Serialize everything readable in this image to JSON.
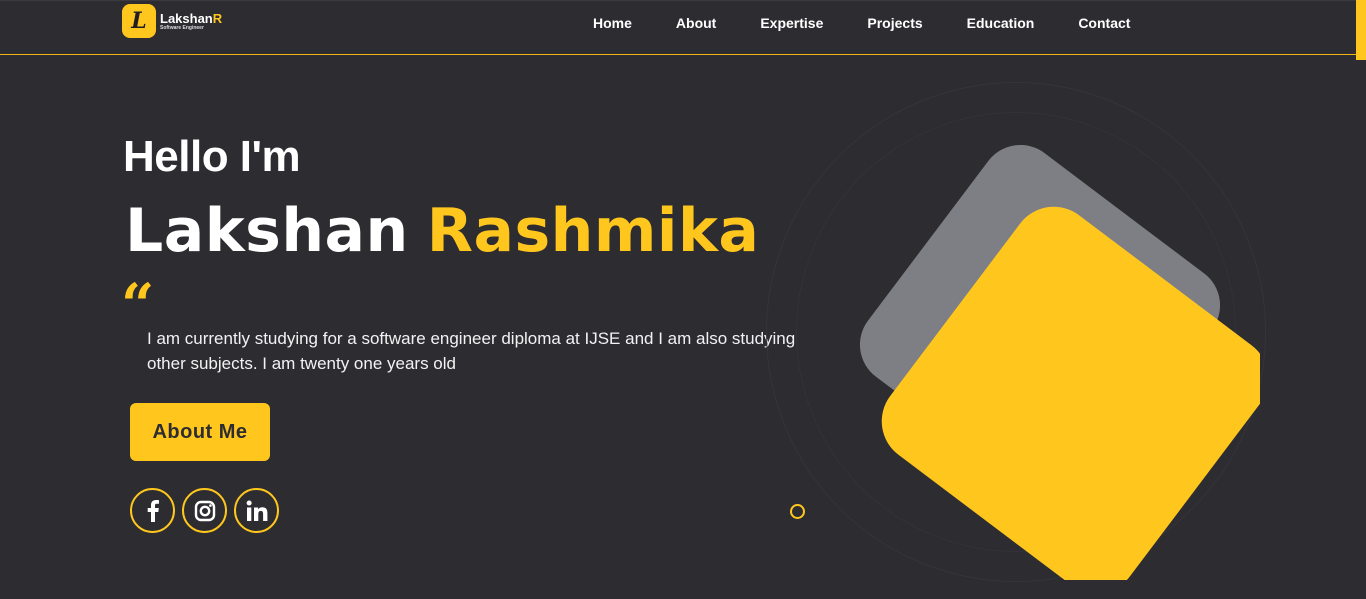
{
  "logo": {
    "letter": "L",
    "name_main": "Lakshan",
    "name_accent": "R",
    "subtitle": "Software Engineer"
  },
  "nav": {
    "items": [
      "Home",
      "About",
      "Expertise",
      "Projects",
      "Education",
      "Contact"
    ]
  },
  "hero": {
    "greeting": "Hello I'm",
    "first_name": "Lakshan",
    "last_name": "Rashmika",
    "quote_mark": "“",
    "bio": "I am currently studying for a software engineer diploma at IJSE and I am also studying other subjects. I am twenty one years old",
    "cta_label": "About Me"
  },
  "socials": [
    {
      "name": "facebook",
      "icon": "facebook-icon"
    },
    {
      "name": "instagram",
      "icon": "instagram-icon"
    },
    {
      "name": "linkedin",
      "icon": "linkedin-icon"
    }
  ],
  "colors": {
    "background": "#2d2c31",
    "accent": "#ffc71e",
    "gray_shape": "#7e7f84"
  }
}
